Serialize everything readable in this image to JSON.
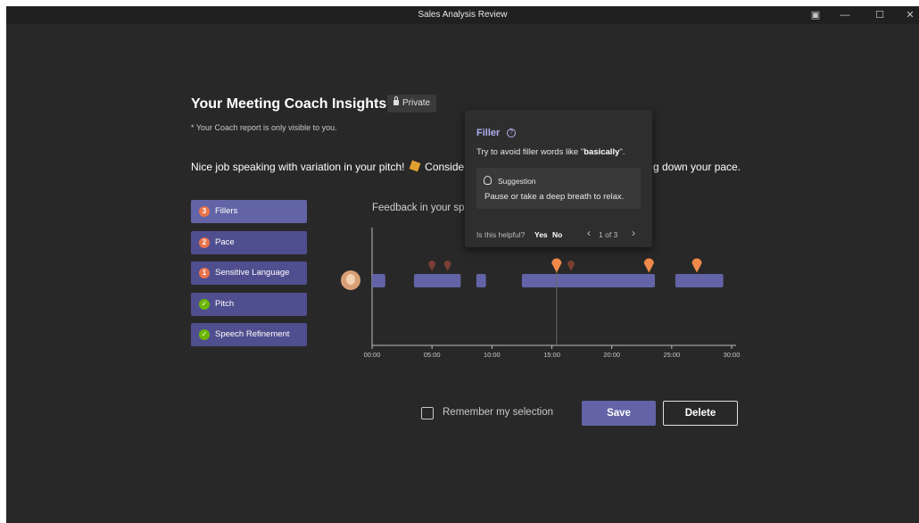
{
  "window": {
    "title": "Sales Analysis Review",
    "controls": [
      "restore-screen",
      "minimize",
      "maximize",
      "close"
    ]
  },
  "header": {
    "title": "Your Meeting Coach Insights",
    "private_label": "Private",
    "note": "* Your Coach report is only visible to you."
  },
  "summary": {
    "text_start": "Nice job speaking with variation in your pitch!",
    "text_mid": "Conside",
    "text_end": "g down your pace."
  },
  "categories": [
    {
      "badge": "3",
      "badge_type": "count",
      "label": "Fillers",
      "active": true
    },
    {
      "badge": "2",
      "badge_type": "count",
      "label": "Pace",
      "active": false
    },
    {
      "badge": "1",
      "badge_type": "count",
      "label": "Sensitive Language",
      "active": false
    },
    {
      "badge": "✓",
      "badge_type": "check",
      "label": "Pitch",
      "active": false
    },
    {
      "badge": "✓",
      "badge_type": "check",
      "label": "Speech Refinement",
      "active": false
    }
  ],
  "timeline": {
    "label": "Feedback in your sp",
    "ticks": [
      "00:00",
      "05:00",
      "10:00",
      "15:00",
      "20:00",
      "25:00",
      "30:00"
    ],
    "total_minutes": 30,
    "segments": [
      [
        0,
        1.1
      ],
      [
        3.5,
        7.4
      ],
      [
        8.7,
        9.5
      ],
      [
        12.5,
        23.6
      ],
      [
        25.3,
        29.3
      ]
    ],
    "markers_dim": [
      5,
      6.3,
      16.6
    ],
    "markers_bright": [
      15.4,
      23.1,
      27.1
    ],
    "cursor_minute": 15.4
  },
  "popup": {
    "title": "Filler",
    "body_prefix": "Try to avoid filler words like \"",
    "body_word": "basically",
    "body_suffix": "\".",
    "suggestion_label": "Suggestion",
    "suggestion_text": "Pause or take a deep breath to relax.",
    "helpful_label": "Is this helpful?",
    "yes": "Yes",
    "no": "No",
    "pager": "1 of 3"
  },
  "footer": {
    "remember_label": "Remember my selection",
    "save_label": "Save",
    "delete_label": "Delete"
  },
  "colors": {
    "accent": "#6264a7",
    "marker": "#f08a4b",
    "marker_dim": "#7a3f33",
    "check": "#6bb700"
  }
}
